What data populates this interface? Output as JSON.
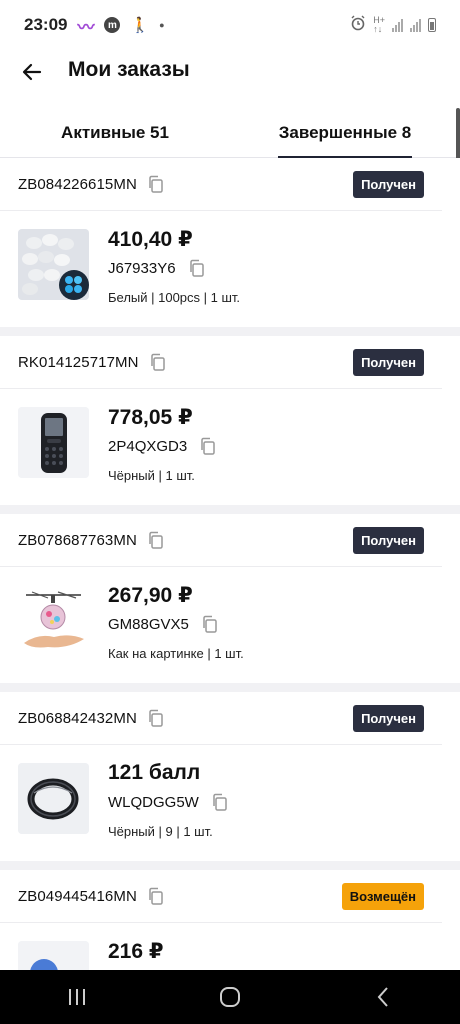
{
  "status_bar": {
    "time": "23:09",
    "icons": [
      "purple-wave-icon",
      "m-app-icon",
      "walking-icon",
      "dot-icon",
      "alarm-icon",
      "wifi-icon",
      "signal-icon",
      "signal-icon",
      "battery-icon"
    ]
  },
  "header": {
    "title": "Мои заказы",
    "back_icon": "arrow-left-icon"
  },
  "tabs": [
    {
      "label": "Активные 51",
      "active": false
    },
    {
      "label": "Завершенные 8",
      "active": true
    }
  ],
  "orders": [
    {
      "id": "ZB084226615MN",
      "status": "Получен",
      "price": "410,40 ₽",
      "sku": "J67933Y6",
      "variant": "Белый | 100pcs | 1 шт.",
      "image": "glow-stones-image"
    },
    {
      "id": "RK014125717MN",
      "status": "Получен",
      "price": "778,05 ₽",
      "sku": "2P4QXGD3",
      "variant": "Чёрный | 1 шт.",
      "image": "mini-phone-image"
    },
    {
      "id": "ZB078687763MN",
      "status": "Получен",
      "price": "267,90 ₽",
      "sku": "GM88GVX5",
      "variant": "Как на картинке | 1 шт.",
      "image": "flying-ball-image"
    },
    {
      "id": "ZB068842432MN",
      "status": "Получен",
      "price": "121 балл",
      "sku": "WLQDGG5W",
      "variant": "Чёрный | 9 | 1 шт.",
      "image": "ring-image"
    },
    {
      "id": "ZB049445416MN",
      "status": "Возмещён",
      "price": "216 ₽",
      "sku": "",
      "variant": "",
      "image": "blue-item-image"
    }
  ],
  "colors": {
    "badge_dark": "#2b2f40",
    "badge_refund": "#f5a20a",
    "divider": "#f1f1f4"
  },
  "nav": {
    "recent_icon": "recent-apps-icon",
    "home_icon": "home-icon",
    "back_icon": "back-chevron-icon"
  }
}
